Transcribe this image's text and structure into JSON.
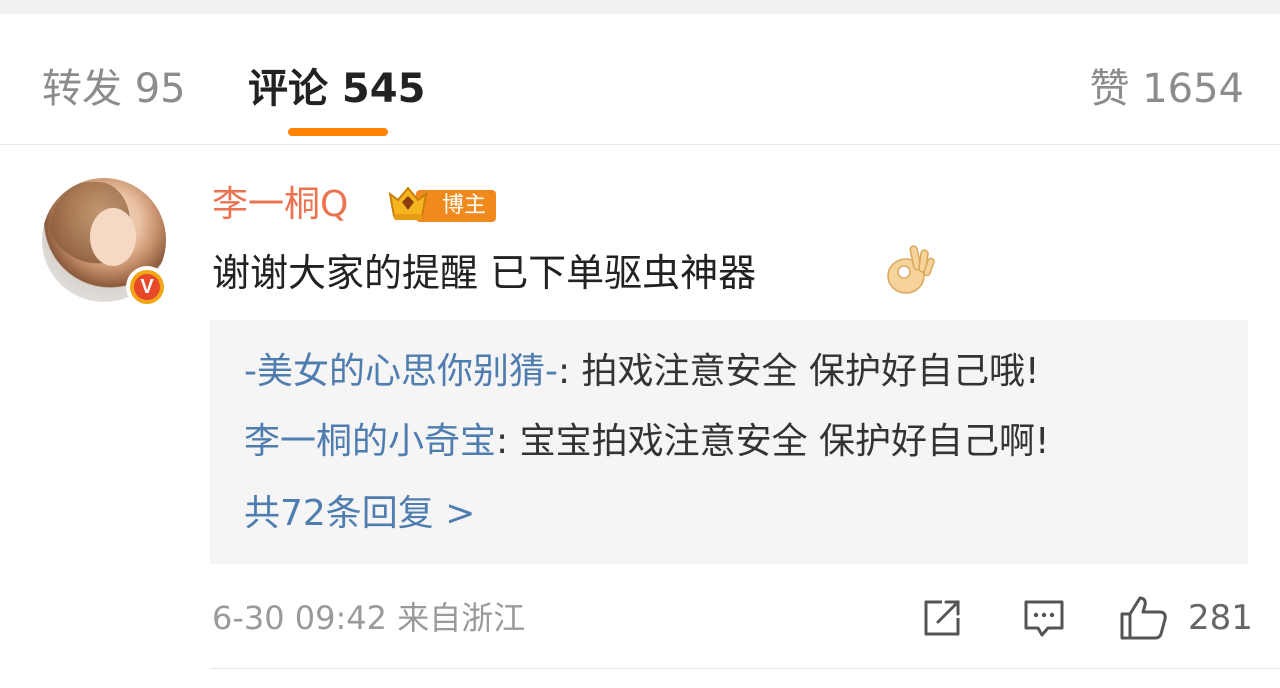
{
  "tabs": {
    "repost": "转发 95",
    "comments": "评论 545",
    "likes": "赞 1654",
    "accent_color": "#ff8200"
  },
  "comment": {
    "username": "李一桐Q",
    "author_badge": "博主",
    "text": "谢谢大家的提醒 已下单驱虫神器",
    "emoji": "ok-hand",
    "replies": [
      {
        "name": "-美女的心思你别猜-",
        "text": ": 拍戏注意安全 保护好自己哦!"
      },
      {
        "name": "李一桐的小奇宝",
        "text": ": 宝宝拍戏注意安全 保护好自己啊!"
      }
    ],
    "more_replies": "共72条回复 >",
    "meta": "6-30 09:42 来自浙江",
    "like_count": "281"
  },
  "colors": {
    "username": "#eb7350",
    "reply_name": "#507daf",
    "badge": "#f08a1c"
  }
}
